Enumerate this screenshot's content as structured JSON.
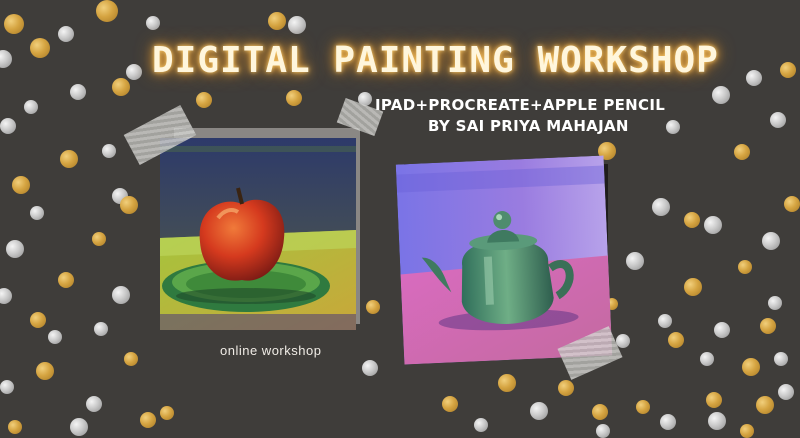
{
  "banner": {
    "title": "DIGITAL PAINTING WORKSHOP",
    "subtitle_line1": "IPAD+PROCREATE+APPLE PENCIL",
    "subtitle_line2": "BY SAI PRIYA MAHAJAN",
    "tagline": "online workshop"
  },
  "colors": {
    "background": "#3f3d3a",
    "title_glow": "#f0a73a",
    "dot_gold": "#d5a441",
    "dot_silver": "#c9c9c9"
  },
  "artworks": [
    {
      "subject": "apple-on-plate-painting"
    },
    {
      "subject": "teapot-painting"
    }
  ]
}
